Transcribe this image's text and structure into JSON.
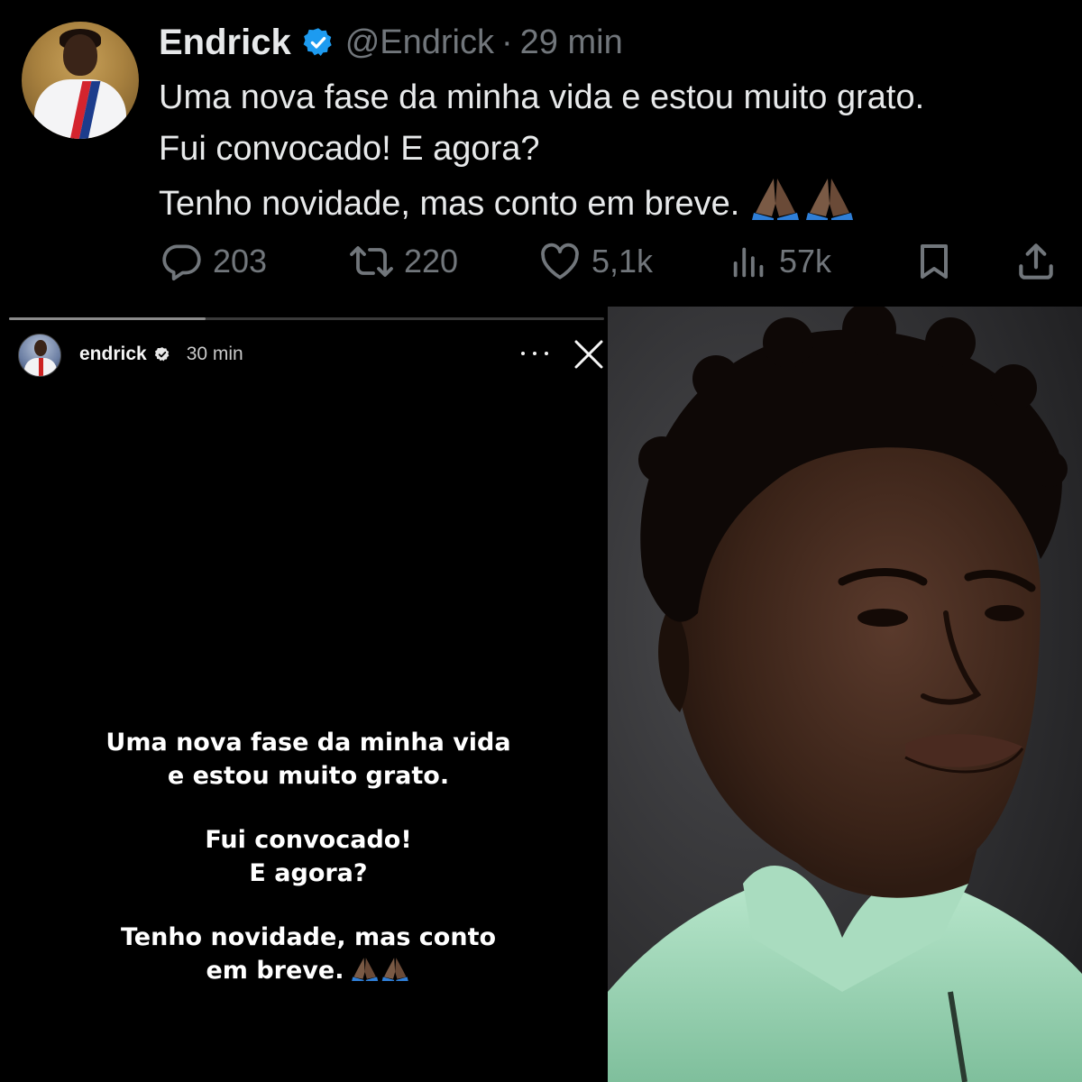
{
  "tweet": {
    "name": "Endrick",
    "handle": "@Endrick",
    "dot": "·",
    "time": "29 min",
    "lines": [
      "Uma nova fase da minha vida e estou muito grato.",
      "Fui convocado! E agora?",
      "Tenho novidade, mas conto em breve."
    ],
    "stats": {
      "replies": "203",
      "reposts": "220",
      "likes": "5,1k",
      "views": "57k"
    },
    "icons": [
      "verified-badge-icon",
      "reply-icon",
      "repost-icon",
      "like-icon",
      "views-icon",
      "bookmark-icon",
      "share-icon"
    ],
    "colors": {
      "verified": "#1d9bf0",
      "muted": "#71767b",
      "text": "#e7e9ea"
    }
  },
  "story": {
    "username": "endrick",
    "time": "30 min",
    "progress": 0.33,
    "caption": {
      "paragraph1": [
        "Uma nova fase da minha vida",
        "e estou muito grato."
      ],
      "paragraph2": [
        "Fui convocado!",
        "E agora?"
      ],
      "paragraph3": [
        "Tenho novidade, mas conto",
        "em breve."
      ]
    },
    "icons": [
      "verified-badge-icon",
      "more-options-icon",
      "close-icon"
    ]
  },
  "portrait": {
    "colors": {
      "background": "#2b2b2d",
      "jacket": "#9fd3b4"
    }
  }
}
